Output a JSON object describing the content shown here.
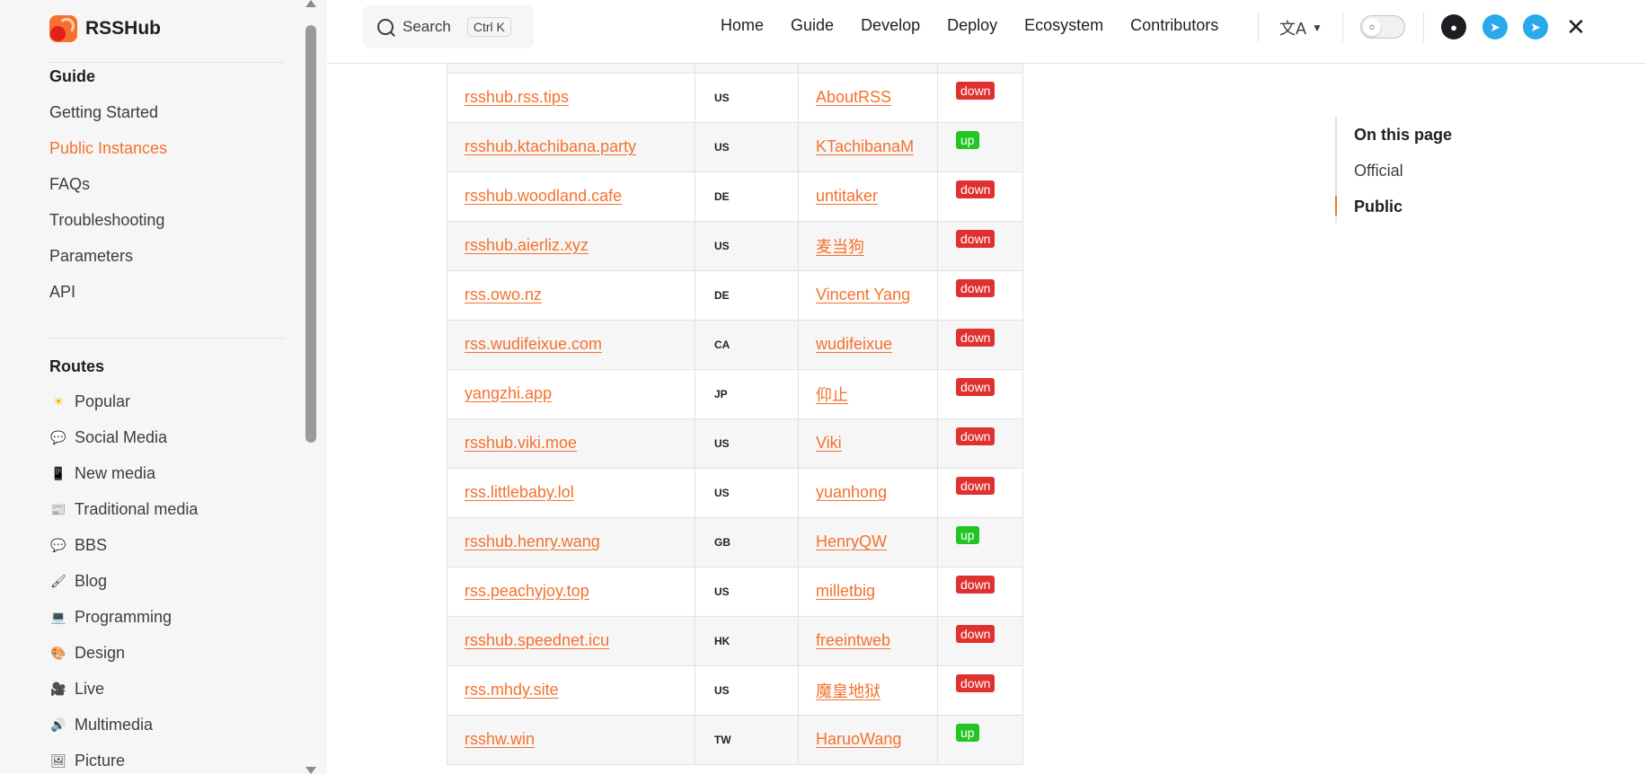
{
  "brand": {
    "name": "RSSHub"
  },
  "search": {
    "label": "Search",
    "shortcut": "Ctrl K"
  },
  "nav": {
    "links": [
      "Home",
      "Guide",
      "Develop",
      "Deploy",
      "Ecosystem",
      "Contributors"
    ]
  },
  "sidebar": {
    "guide_title": "Guide",
    "guide_items": [
      "Getting Started",
      "Public Instances",
      "FAQs",
      "Troubleshooting",
      "Parameters",
      "API"
    ],
    "routes_title": "Routes",
    "routes_items": [
      {
        "emoji": "☀",
        "label": "Popular"
      },
      {
        "emoji": "💬",
        "label": "Social Media"
      },
      {
        "emoji": "📱",
        "label": "New media"
      },
      {
        "emoji": "📰",
        "label": "Traditional media"
      },
      {
        "emoji": "💬",
        "label": "BBS"
      },
      {
        "emoji": "🖌",
        "label": "Blog"
      },
      {
        "emoji": "💻",
        "label": "Programming"
      },
      {
        "emoji": "🎨",
        "label": "Design"
      },
      {
        "emoji": "🎥",
        "label": "Live"
      },
      {
        "emoji": "🔊",
        "label": "Multimedia"
      },
      {
        "emoji": "🖼",
        "label": "Picture"
      }
    ]
  },
  "instances": [
    {
      "url": "rsshub.rss.tips",
      "country": "US",
      "maintainer": "AboutRSS",
      "status": "down"
    },
    {
      "url": "rsshub.ktachibana.party",
      "country": "US",
      "maintainer": "KTachibanaM",
      "status": "up"
    },
    {
      "url": "rsshub.woodland.cafe",
      "country": "DE",
      "maintainer": "untitaker",
      "status": "down"
    },
    {
      "url": "rsshub.aierliz.xyz",
      "country": "US",
      "maintainer": "麦当狗",
      "status": "down"
    },
    {
      "url": "rss.owo.nz",
      "country": "DE",
      "maintainer": "Vincent Yang",
      "status": "down"
    },
    {
      "url": "rss.wudifeixue.com",
      "country": "CA",
      "maintainer": "wudifeixue",
      "status": "down"
    },
    {
      "url": "yangzhi.app",
      "country": "JP",
      "maintainer": "仰止",
      "status": "down"
    },
    {
      "url": "rsshub.viki.moe",
      "country": "US",
      "maintainer": "Viki",
      "status": "down"
    },
    {
      "url": "rss.littlebaby.lol",
      "country": "US",
      "maintainer": "yuanhong",
      "status": "down"
    },
    {
      "url": "rsshub.henry.wang",
      "country": "GB",
      "maintainer": "HenryQW",
      "status": "up"
    },
    {
      "url": "rss.peachyjoy.top",
      "country": "US",
      "maintainer": "milletbig",
      "status": "down"
    },
    {
      "url": "rsshub.speednet.icu",
      "country": "HK",
      "maintainer": "freeintweb",
      "status": "down"
    },
    {
      "url": "rss.mhdy.site",
      "country": "US",
      "maintainer": "魔皇地狱",
      "status": "down"
    },
    {
      "url": "rsshw.win",
      "country": "TW",
      "maintainer": "HaruoWang",
      "status": "up"
    }
  ],
  "toc": {
    "title": "On this page",
    "items": [
      "Official",
      "Public"
    ]
  },
  "colors": {
    "accent": "#f5712c",
    "down": "#e03131",
    "up": "#22c522"
  }
}
